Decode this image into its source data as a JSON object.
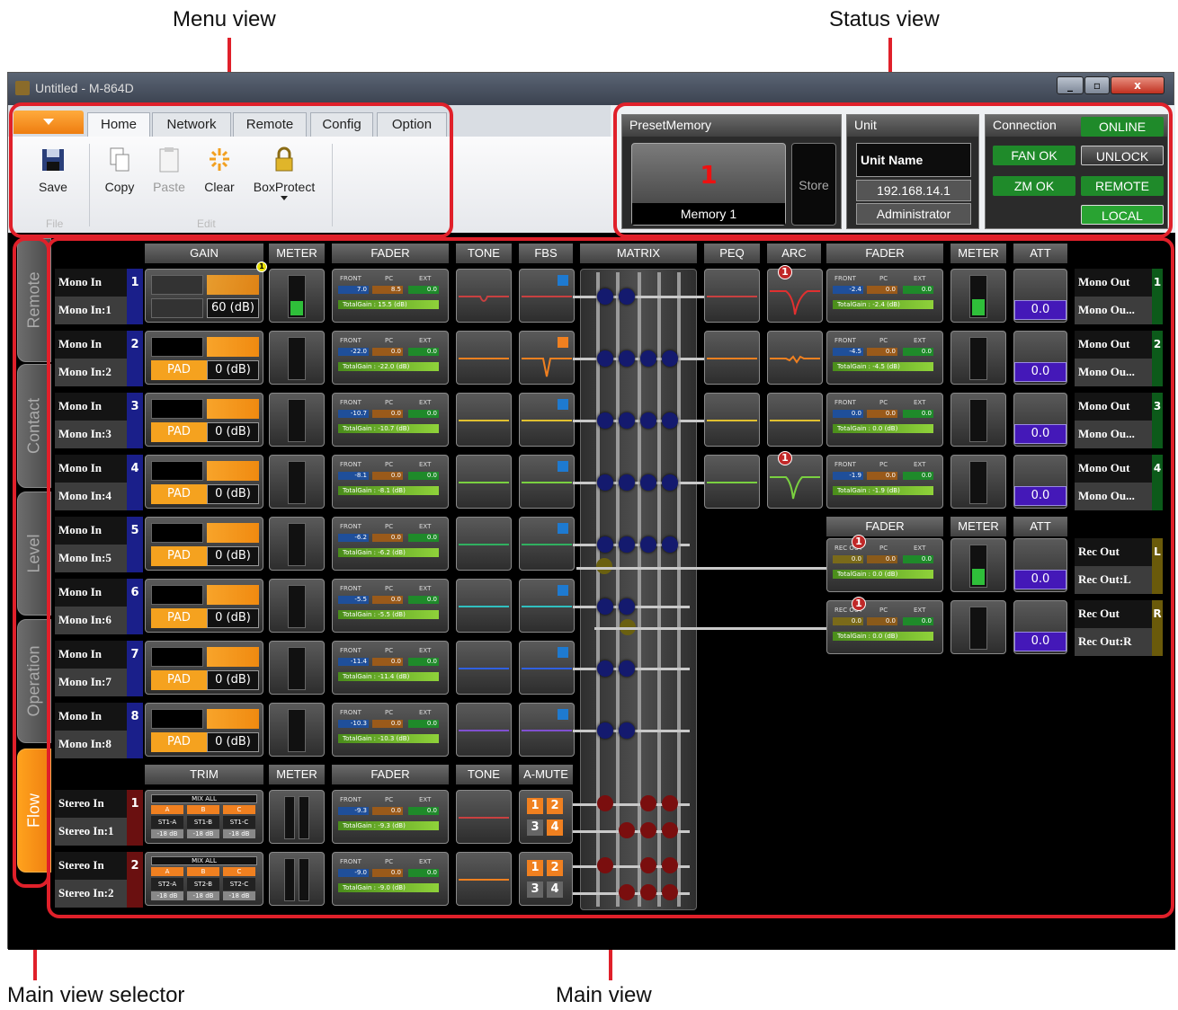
{
  "callouts": {
    "menu": "Menu view",
    "status": "Status view",
    "selector": "Main view selector",
    "main": "Main view"
  },
  "window": {
    "title": "Untitled - M-864D",
    "min": "_",
    "max": "▫",
    "close": "x"
  },
  "ribbon": {
    "tabs": [
      "Home",
      "Network",
      "Remote",
      "Config",
      "Option"
    ],
    "active_tab": "Home",
    "buttons": {
      "save": "Save",
      "copy": "Copy",
      "paste": "Paste",
      "clear": "Clear",
      "boxprotect": "BoxProtect"
    },
    "groups": {
      "file": "File",
      "edit": "Edit"
    }
  },
  "status": {
    "preset": {
      "title": "PresetMemory",
      "number": "1",
      "name": "Memory 1",
      "store": "Store"
    },
    "unit": {
      "title": "Unit",
      "name": "Unit Name",
      "ip": "192.168.14.1",
      "user": "Administrator"
    },
    "connection": {
      "title": "Connection",
      "online": "ONLINE",
      "fan": "FAN OK",
      "unlock": "UNLOCK",
      "zm": "ZM OK",
      "remote": "REMOTE",
      "local": "LOCAL"
    }
  },
  "sidebar": {
    "tabs": [
      "Remote",
      "Contact",
      "Level",
      "Operation",
      "Flow"
    ],
    "active": "Flow"
  },
  "headers": {
    "gain": "GAIN",
    "meter": "METER",
    "fader": "FADER",
    "tone": "TONE",
    "fbs": "FBS",
    "matrix": "MATRIX",
    "peq": "PEQ",
    "arc": "ARC",
    "fader_out": "FADER",
    "meter_out": "METER",
    "att": "ATT",
    "rec_fader": "FADER",
    "rec_meter": "METER",
    "rec_att": "ATT",
    "trim": "TRIM",
    "st_meter": "METER",
    "st_fader": "FADER",
    "st_tone": "TONE",
    "amute": "A-MUTE"
  },
  "inputs": [
    {
      "type": "Mono In",
      "name": "Mono In:1",
      "num": "1",
      "gain": "60 (dB)",
      "pad": "",
      "front": "7.0",
      "pc": "8.5",
      "ext": "0.0",
      "total": "TotalGain : 15.5 (dB)"
    },
    {
      "type": "Mono In",
      "name": "Mono In:2",
      "num": "2",
      "gain": "0 (dB)",
      "pad": "PAD",
      "front": "-22.0",
      "pc": "0.0",
      "ext": "0.0",
      "total": "TotalGain : -22.0 (dB)"
    },
    {
      "type": "Mono In",
      "name": "Mono In:3",
      "num": "3",
      "gain": "0 (dB)",
      "pad": "PAD",
      "front": "-10.7",
      "pc": "0.0",
      "ext": "0.0",
      "total": "TotalGain : -10.7 (dB)"
    },
    {
      "type": "Mono In",
      "name": "Mono In:4",
      "num": "4",
      "gain": "0 (dB)",
      "pad": "PAD",
      "front": "-8.1",
      "pc": "0.0",
      "ext": "0.0",
      "total": "TotalGain : -8.1 (dB)"
    },
    {
      "type": "Mono In",
      "name": "Mono In:5",
      "num": "5",
      "gain": "0 (dB)",
      "pad": "PAD",
      "front": "-6.2",
      "pc": "0.0",
      "ext": "0.0",
      "total": "TotalGain : -6.2 (dB)"
    },
    {
      "type": "Mono In",
      "name": "Mono In:6",
      "num": "6",
      "gain": "0 (dB)",
      "pad": "PAD",
      "front": "-5.5",
      "pc": "0.0",
      "ext": "0.0",
      "total": "TotalGain : -5.5 (dB)"
    },
    {
      "type": "Mono In",
      "name": "Mono In:7",
      "num": "7",
      "gain": "0 (dB)",
      "pad": "PAD",
      "front": "-11.4",
      "pc": "0.0",
      "ext": "0.0",
      "total": "TotalGain : -11.4 (dB)"
    },
    {
      "type": "Mono In",
      "name": "Mono In:8",
      "num": "8",
      "gain": "0 (dB)",
      "pad": "PAD",
      "front": "-10.3",
      "pc": "0.0",
      "ext": "0.0",
      "total": "TotalGain : -10.3 (dB)"
    }
  ],
  "stereo": [
    {
      "type": "Stereo In",
      "name": "Stereo In:1",
      "num": "1",
      "mix": "MIX ALL",
      "a": "A",
      "b": "B",
      "c": "C",
      "ch": [
        "ST1-A",
        "ST1-B",
        "ST1-C"
      ],
      "db": "-18 dB",
      "front": "-9.3",
      "pc": "0.0",
      "ext": "0.0",
      "total": "TotalGain : -9.3 (dB)"
    },
    {
      "type": "Stereo In",
      "name": "Stereo In:2",
      "num": "2",
      "mix": "MIX ALL",
      "a": "A",
      "b": "B",
      "c": "C",
      "ch": [
        "ST2-A",
        "ST2-B",
        "ST2-C"
      ],
      "db": "-18 dB",
      "front": "-9.0",
      "pc": "0.0",
      "ext": "0.0",
      "total": "TotalGain : -9.0 (dB)"
    }
  ],
  "amute": [
    "1",
    "2",
    "3",
    "4"
  ],
  "outputs": [
    {
      "type": "Mono Out",
      "name": "Mono Ou...",
      "num": "1",
      "front": "-2.4",
      "pc": "0.0",
      "ext": "0.0",
      "total": "TotalGain : -2.4 (dB)",
      "att": "0.0"
    },
    {
      "type": "Mono Out",
      "name": "Mono Ou...",
      "num": "2",
      "front": "-4.5",
      "pc": "0.0",
      "ext": "0.0",
      "total": "TotalGain : -4.5 (dB)",
      "att": "0.0"
    },
    {
      "type": "Mono Out",
      "name": "Mono Ou...",
      "num": "3",
      "front": "0.0",
      "pc": "0.0",
      "ext": "0.0",
      "total": "TotalGain : 0.0 (dB)",
      "att": "0.0"
    },
    {
      "type": "Mono Out",
      "name": "Mono Ou...",
      "num": "4",
      "front": "-1.9",
      "pc": "0.0",
      "ext": "0.0",
      "total": "TotalGain : -1.9 (dB)",
      "att": "0.0"
    }
  ],
  "rec": [
    {
      "type": "Rec Out",
      "name": "Rec Out:L",
      "side": "L",
      "front": "0.0",
      "pc": "0.0",
      "ext": "0.0",
      "total": "TotalGain : 0.0 (dB)",
      "att": "0.0"
    },
    {
      "type": "Rec Out",
      "name": "Rec Out:R",
      "side": "R",
      "front": "0.0",
      "pc": "0.0",
      "ext": "0.0",
      "total": "TotalGain : 0.0 (dB)",
      "att": "0.0"
    }
  ],
  "fader_labels": {
    "front": "FRONT",
    "pc": "PC",
    "ext": "EXT",
    "rec": "REC OUT"
  },
  "badge": "1",
  "colors": {
    "accent": "#f5a21f",
    "online": "#1f8a2a",
    "mono_in": "#1a1f8a",
    "stereo_in": "#6a1010",
    "att": "#4418b8"
  }
}
